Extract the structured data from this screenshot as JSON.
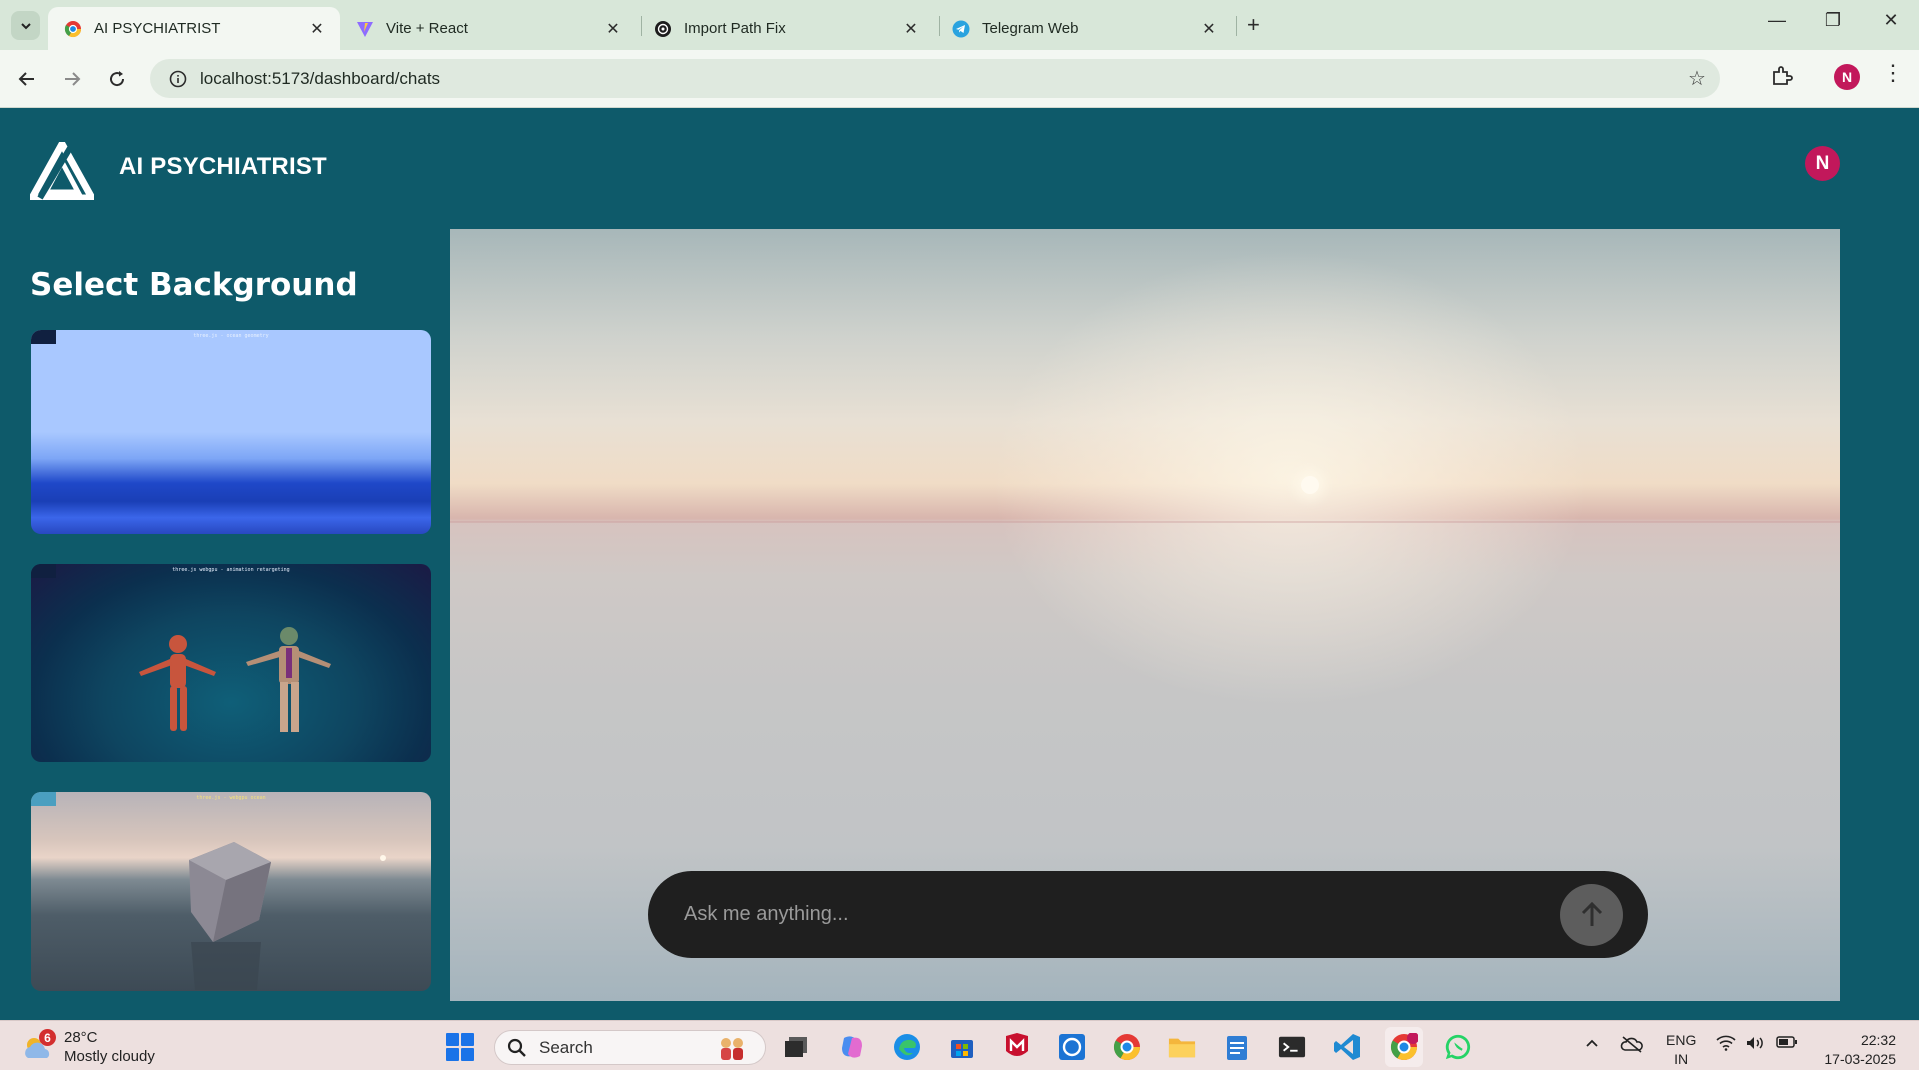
{
  "browser": {
    "tabs": [
      {
        "title": "AI PSYCHIATRIST",
        "active": true,
        "icon": "chrome-favicon"
      },
      {
        "title": "Vite + React",
        "active": false,
        "icon": "vite-icon"
      },
      {
        "title": "Import Path Fix",
        "active": false,
        "icon": "openai-icon"
      },
      {
        "title": "Telegram Web",
        "active": false,
        "icon": "telegram-icon"
      }
    ],
    "address": "localhost:5173/dashboard/chats",
    "profile_initial": "N"
  },
  "app": {
    "brand": "AI PSYCHIATRIST",
    "user_initial": "N",
    "sidebar": {
      "heading": "Select Background",
      "backgrounds": [
        {
          "caption": "three.js - ocean geometry"
        },
        {
          "caption": "three.js webgpu - animation retargeting"
        },
        {
          "caption": "three.js - webgpu ocean"
        }
      ]
    },
    "chat": {
      "placeholder": "Ask me anything..."
    }
  },
  "taskbar": {
    "weather": {
      "temp": "28°C",
      "condition": "Mostly cloudy",
      "alerts": "6"
    },
    "search_label": "Search",
    "language": {
      "line1": "ENG",
      "line2": "IN"
    },
    "time": "22:32",
    "date": "17-03-2025"
  },
  "colors": {
    "app_background": "#0e5a6a",
    "accent_avatar": "#c2185b",
    "chat_bar": "#1f1f1f"
  }
}
